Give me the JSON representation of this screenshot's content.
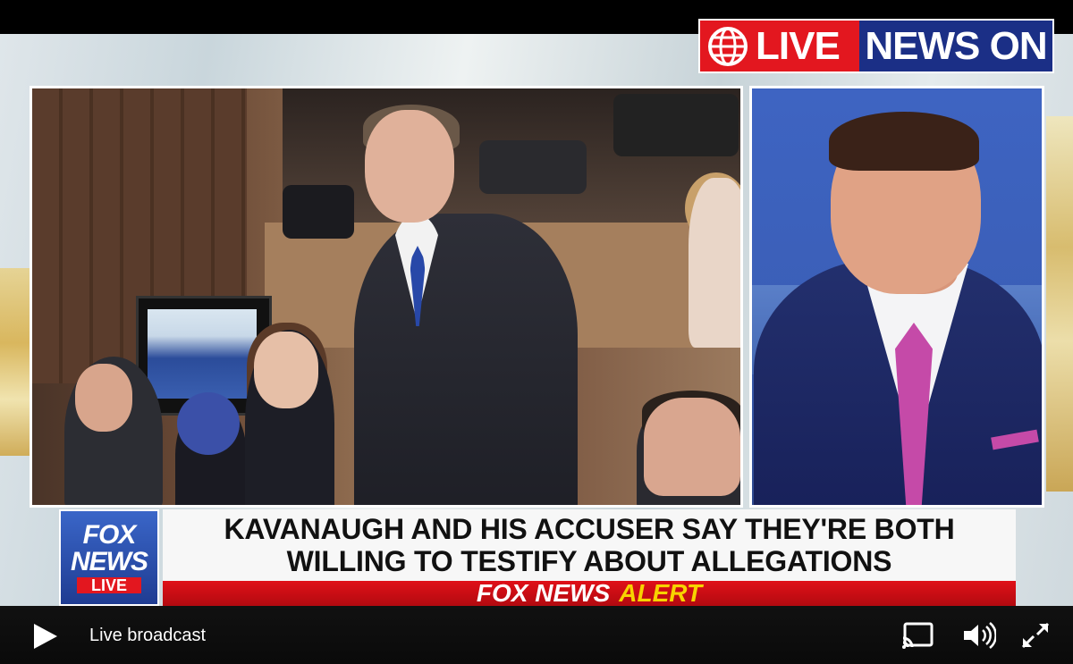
{
  "badge": {
    "live": "LIVE",
    "news_on": "NEWS ON"
  },
  "lower_third": {
    "headline_line1": "KAVANAUGH AND HIS ACCUSER SAY THEY'RE BOTH",
    "headline_line2": "WILLING TO TESTIFY ABOUT ALLEGATIONS",
    "alert_brand": "FOX NEWS",
    "alert_word": "ALERT"
  },
  "fox_logo": {
    "line1": "FOX",
    "line2": "NEWS",
    "line3": "LIVE"
  },
  "player": {
    "status_text": "Live broadcast",
    "icons": [
      "play-icon",
      "cast-icon",
      "volume-icon",
      "fullscreen-icon"
    ]
  },
  "colors": {
    "badge_red": "#e3171f",
    "badge_blue": "#1b2f86",
    "alert_red": "#d60e16",
    "alert_yellow": "#f7d300",
    "fox_blue": "#2a52b0"
  }
}
